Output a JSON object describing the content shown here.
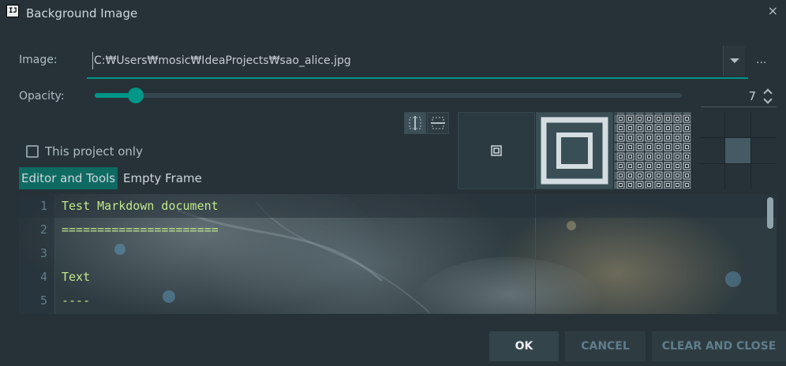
{
  "dialog": {
    "title": "Background Image",
    "close_glyph": "×",
    "app_icon_text": "IJ"
  },
  "image": {
    "label": "Image:",
    "path": "C:₩Users₩mosic₩IdeaProjects₩sao_alice.jpg",
    "browse_label": "..."
  },
  "opacity": {
    "label": "Opacity:",
    "value": "7",
    "level": 0.07
  },
  "this_project": {
    "label": "This project only",
    "checked": false
  },
  "tabs": [
    {
      "label": "Editor and Tools",
      "active": true
    },
    {
      "label": "Empty Frame",
      "active": false
    }
  ],
  "editor_preview": {
    "lines": [
      {
        "num": "1",
        "text": "Test Markdown document"
      },
      {
        "num": "2",
        "text": "======================"
      },
      {
        "num": "3",
        "text": ""
      },
      {
        "num": "4",
        "text": "Text"
      },
      {
        "num": "5",
        "text": "----"
      }
    ]
  },
  "fill_options": [
    "center-icon",
    "scale-icon",
    "tile-icon"
  ],
  "anchor": {
    "selected": "center"
  },
  "buttons": {
    "ok": "OK",
    "cancel": "CANCEL",
    "clear": "CLEAR AND CLOSE"
  },
  "colors": {
    "accent": "#009688",
    "background": "#263238",
    "code_text": "#c3e88d",
    "tab_active": "#0f6a62"
  }
}
